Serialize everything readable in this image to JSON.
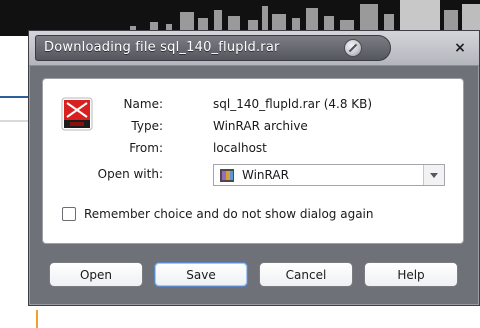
{
  "dialog": {
    "title": "Downloading file sql_140_flupld.rar",
    "close_glyph": "×",
    "icon": "winrar-archive-icon"
  },
  "file": {
    "name_label": "Name:",
    "name_value": "sql_140_flupld.rar (4.8 KB)",
    "type_label": "Type:",
    "type_value": "WinRAR archive",
    "from_label": "From:",
    "from_value": "localhost"
  },
  "open_with": {
    "label": "Open with:",
    "selected": "WinRAR"
  },
  "remember": {
    "label": "Remember choice and do not show dialog again",
    "checked": false
  },
  "buttons": {
    "open": "Open",
    "save": "Save",
    "cancel": "Cancel",
    "help": "Help"
  },
  "colors": {
    "dialog_frame": "#6f7179",
    "title_pill": "#5e6067",
    "default_button_border": "#5a88c6"
  }
}
